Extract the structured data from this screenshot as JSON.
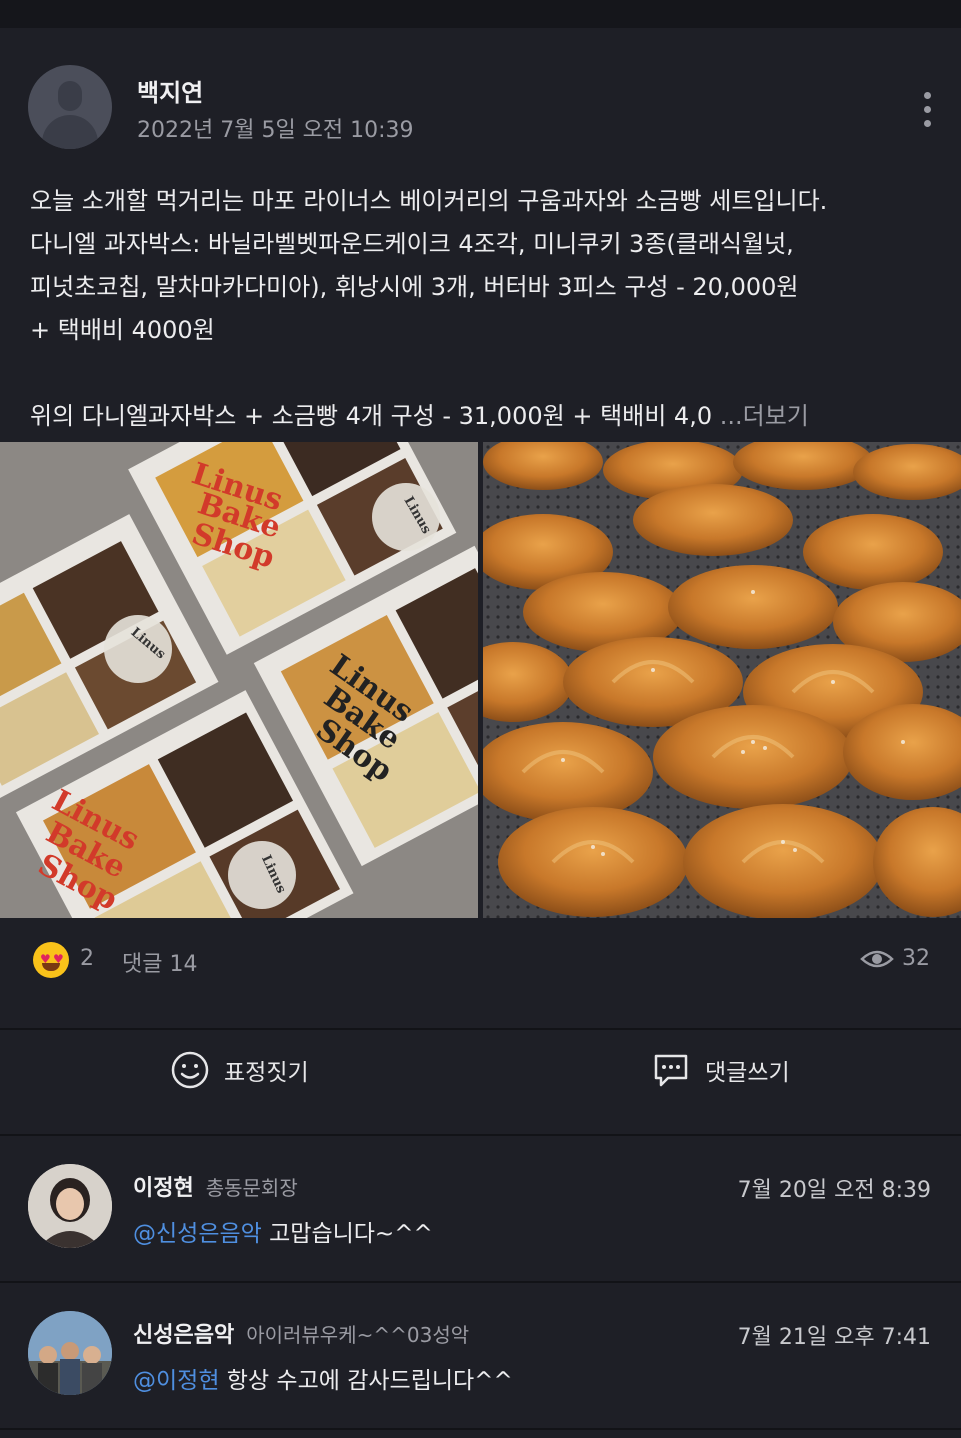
{
  "post": {
    "author": "백지연",
    "time": "2022년 7월 5일 오전 10:39",
    "lines": [
      "오늘 소개할 먹거리는 마포 라이너스 베이커리의 구움과자와 소금빵 세트입니다.",
      "다니엘 과자박스: 바닐라벨벳파운드케이크 4조각, 미니쿠키 3종(클래식월넛,",
      "피넛초코칩, 말차마카다미아), 휘낭시에 3개, 버터바 3피스 구성 - 20,000원",
      "+ 택배비 4000원",
      "위의 다니엘과자박스 + 소금빵 4개 구성 - 31,000원 + 택배비 4,0"
    ],
    "more_label": "...더보기",
    "photo_left_text": "Linus Bake Shop",
    "reactions": "2",
    "comments_label": "댓글 14",
    "views": "32",
    "emoji": "heart-eyes-emoji"
  },
  "actions": {
    "react_label": "표정짓기",
    "comment_label": "댓글쓰기"
  },
  "comments": [
    {
      "name": "이정현",
      "role": "총동문회장",
      "time": "7월 20일 오전 8:39",
      "mention": "@신성은음악",
      "text": "고맙습니다~^^"
    },
    {
      "name": "신성은음악",
      "role": "아이러뷰우케~^^03성악",
      "time": "7월 21일 오후 7:41",
      "mention": "@이정현",
      "text": "항상 수고에 감사드립니다^^"
    }
  ],
  "colors": {
    "background": "#1e1f26",
    "mention": "#4f8fe0",
    "muted": "#9a9ba3"
  }
}
